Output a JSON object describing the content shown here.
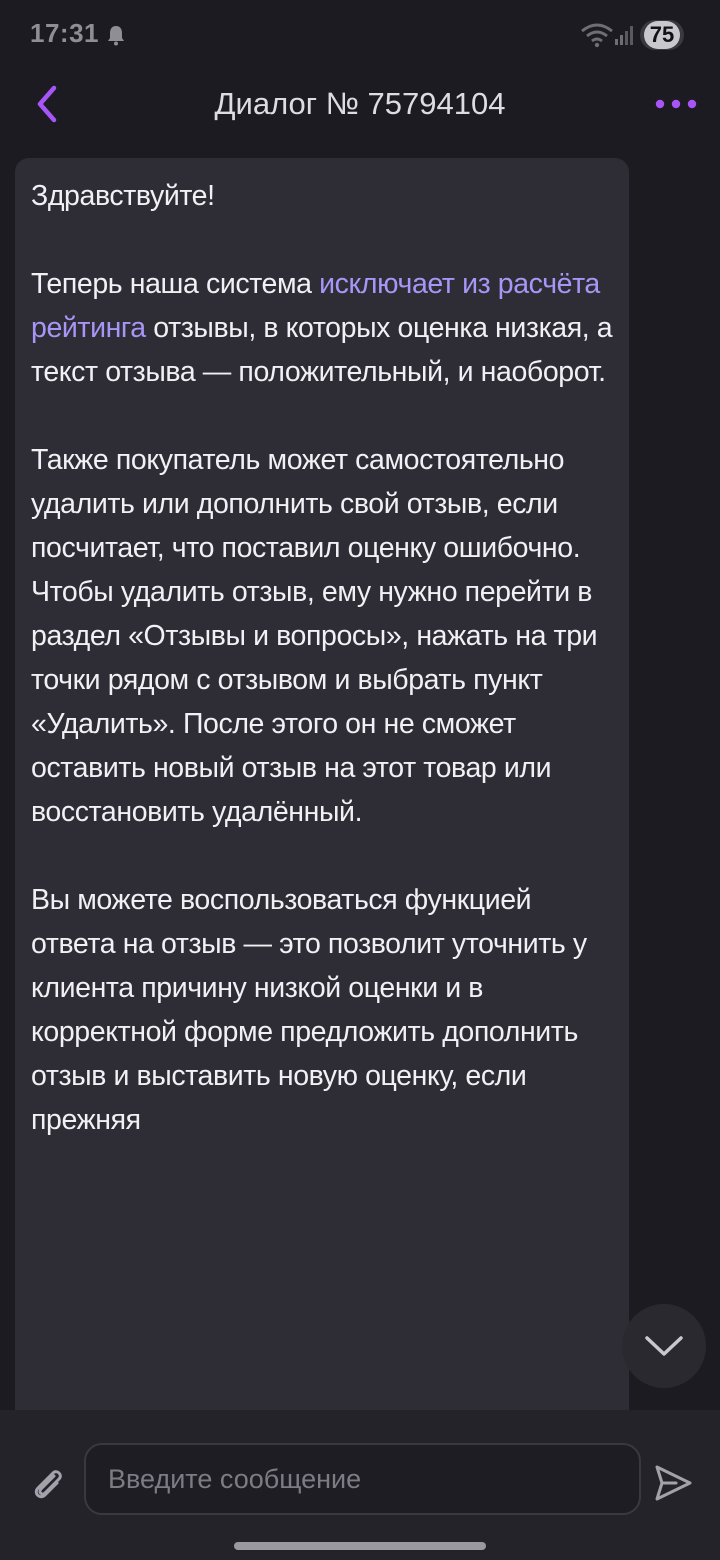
{
  "status_bar": {
    "time": "17:31",
    "battery": "75",
    "icons": [
      "bell-icon",
      "wifi-icon",
      "signal-icon"
    ]
  },
  "header": {
    "title": "Диалог № 75794104",
    "back_icon": "chevron-left-icon",
    "menu_icon": "more-dots-icon"
  },
  "message": {
    "greeting": "Здравствуйте!",
    "p1_before": "Теперь наша система ",
    "p1_link": "исключает из расчёта рейтинга",
    "p1_after": " отзывы, в которых оценка низкая, а текст отзыва — положительный, и наоборот.",
    "p2": "Также покупатель может самостоятельно удалить или дополнить свой отзыв, если посчитает, что поставил оценку ошибочно. Чтобы удалить отзыв, ему нужно перейти в раздел «Отзывы и вопросы», нажать на три точки рядом с отзывом и выбрать пункт «Удалить». После этого он не сможет оставить новый отзыв на этот товар или восстановить удалённый.",
    "p3": "Вы можете воспользоваться функцией ответа на отзыв — это позволит уточнить у клиента причину низкой оценки и в корректной форме предложить дополнить отзыв и выставить новую оценку, если прежняя"
  },
  "composer": {
    "placeholder": "Введите сообщение",
    "value": "",
    "attach_icon": "paperclip-icon",
    "send_icon": "send-icon"
  },
  "colors": {
    "accent": "#a855f7",
    "link": "#a796f5",
    "bubble": "#2e2d35",
    "background": "#1c1b22"
  }
}
